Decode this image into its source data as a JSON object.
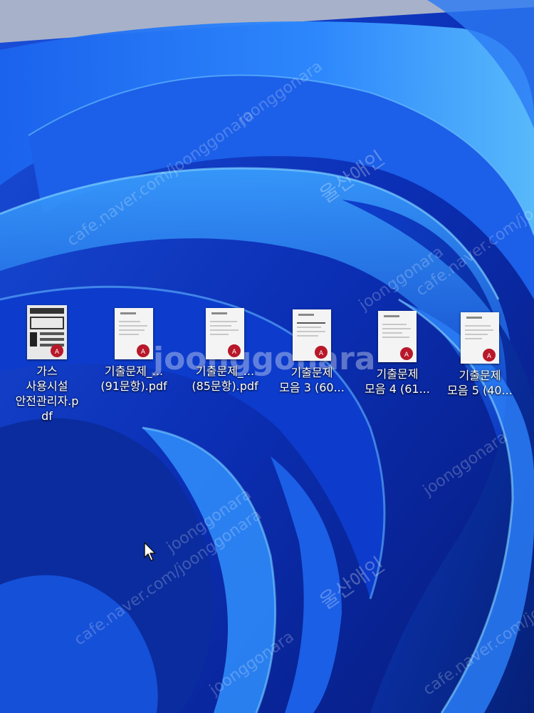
{
  "desktop": {
    "icons": [
      {
        "label": "가스\n사용시설\n안전관리자.p\ndf",
        "icon": "pdf-file-icon"
      },
      {
        "label": "기출문제_...\n(91문항).pdf",
        "icon": "pdf-file-icon"
      },
      {
        "label": "기출문제_...\n(85문항).pdf",
        "icon": "pdf-file-icon"
      },
      {
        "label": "기출문제\n모음 3 (60...",
        "icon": "pdf-file-icon"
      },
      {
        "label": "기출문제\n모음 4 (61...",
        "icon": "pdf-file-icon"
      },
      {
        "label": "기출문제\n모음 5 (40...",
        "icon": "pdf-file-icon"
      }
    ]
  },
  "watermarks": {
    "cafe": "cafe.naver.com/joonggonara",
    "cafe_short": "cafe.naver.com/jo",
    "seller": "울산애인",
    "brand": "joonggonara"
  },
  "colors": {
    "wallpaper_deep": "#0a1f8f",
    "wallpaper_mid": "#1456e0",
    "wallpaper_light": "#4fb0ff",
    "label_text": "#ffffff"
  }
}
